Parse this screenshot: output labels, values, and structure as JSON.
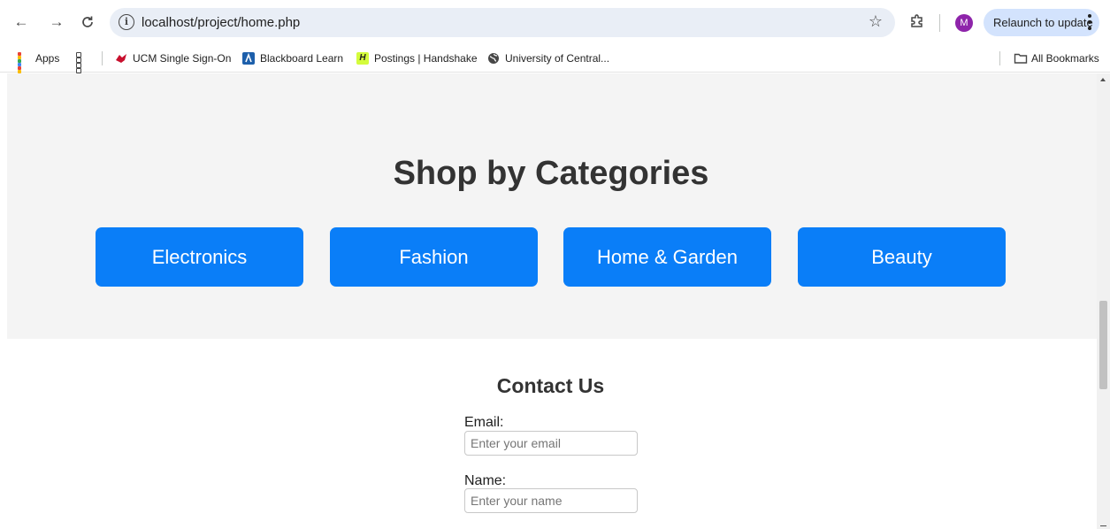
{
  "browser": {
    "url": "localhost/project/home.php",
    "avatar_initial": "M",
    "relaunch_label": "Relaunch to update"
  },
  "bookmarks": {
    "apps": "Apps",
    "items": [
      "UCM Single Sign-On",
      "Blackboard Learn",
      "Postings | Handshake",
      "University of Central..."
    ],
    "all_bookmarks": "All Bookmarks"
  },
  "categories": {
    "title": "Shop by Categories",
    "items": [
      "Electronics",
      "Fashion",
      "Home & Garden",
      "Beauty"
    ],
    "button_color": "#0a7ef8"
  },
  "contact": {
    "title": "Contact Us",
    "email_label": "Email:",
    "email_placeholder": "Enter your email",
    "name_label": "Name:",
    "name_placeholder": "Enter your name"
  }
}
